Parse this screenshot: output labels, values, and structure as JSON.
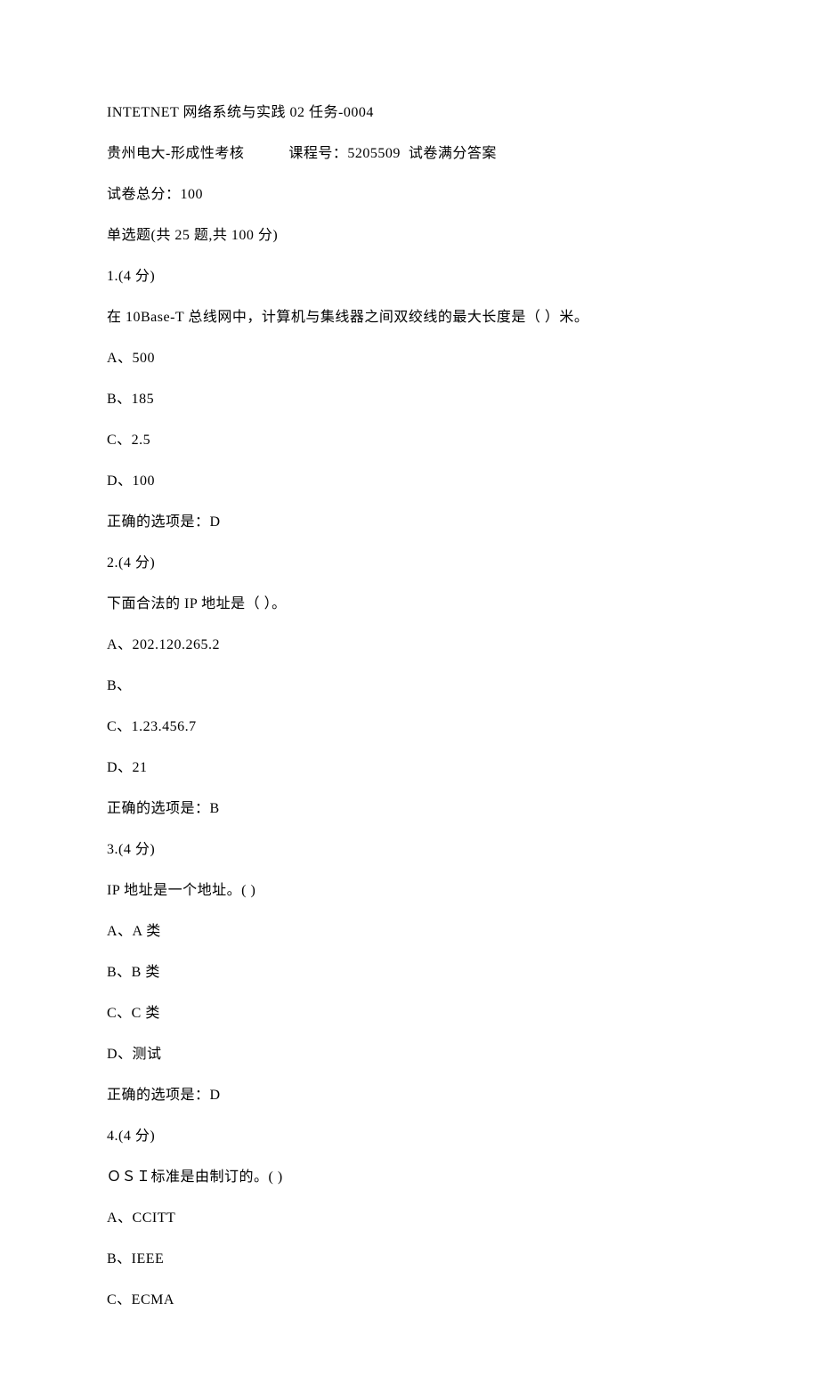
{
  "header": {
    "title": "INTETNET 网络系统与实践 02 任务-0004",
    "school": "贵州电大-形成性考核",
    "course_label": "课程号：",
    "course_number": "5205509",
    "paper_note": "试卷满分答案",
    "total_label": "试卷总分：",
    "total_value": "100",
    "section": "单选题(共 25 题,共 100 分)"
  },
  "questions": [
    {
      "num": "1.(4 分)",
      "stem": "在 10Base-T 总线网中，计算机与集线器之间双绞线的最大长度是（   ）米。",
      "options": [
        "A、500",
        "B、185",
        "C、2.5",
        "D、100"
      ],
      "answer": "正确的选项是：D"
    },
    {
      "num": "2.(4 分)",
      "stem": "下面合法的 IP 地址是（   ）。",
      "options": [
        "A、202.120.265.2",
        "B、",
        "C、1.23.456.7",
        "D、21"
      ],
      "answer": "正确的选项是：B"
    },
    {
      "num": "3.(4 分)",
      "stem": "IP 地址是一个地址。(   )",
      "options": [
        "A、A 类",
        "B、B 类",
        "C、C 类",
        "D、测试"
      ],
      "answer": "正确的选项是：D"
    },
    {
      "num": "4.(4 分)",
      "stem": "ＯＳＩ标准是由制订的。(   )",
      "options": [
        "A、CCITT",
        "B、IEEE",
        "C、ECMA"
      ],
      "answer": ""
    }
  ]
}
